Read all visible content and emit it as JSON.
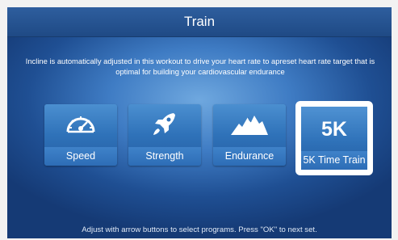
{
  "header": {
    "title": "Train"
  },
  "intro": {
    "text": "Incline is automatically adjusted in this workout to drive your heart rate to  apreset heart rate target that is optimal for building your cardiovascular endurance"
  },
  "programs": [
    {
      "label": "Speed",
      "icon": "speedometer-icon"
    },
    {
      "label": "Strength",
      "icon": "rocket-icon"
    },
    {
      "label": "Endurance",
      "icon": "mountain-icon"
    },
    {
      "label": "5K Time Train",
      "icon_text": "5K",
      "selected": true
    }
  ],
  "footer": {
    "text": "Adjust with arrow buttons to select programs. Press \"OK\" to next set."
  },
  "colors": {
    "background": "#3f7cc4",
    "tile": "#2f72b9",
    "selection_frame": "#ffffff"
  }
}
